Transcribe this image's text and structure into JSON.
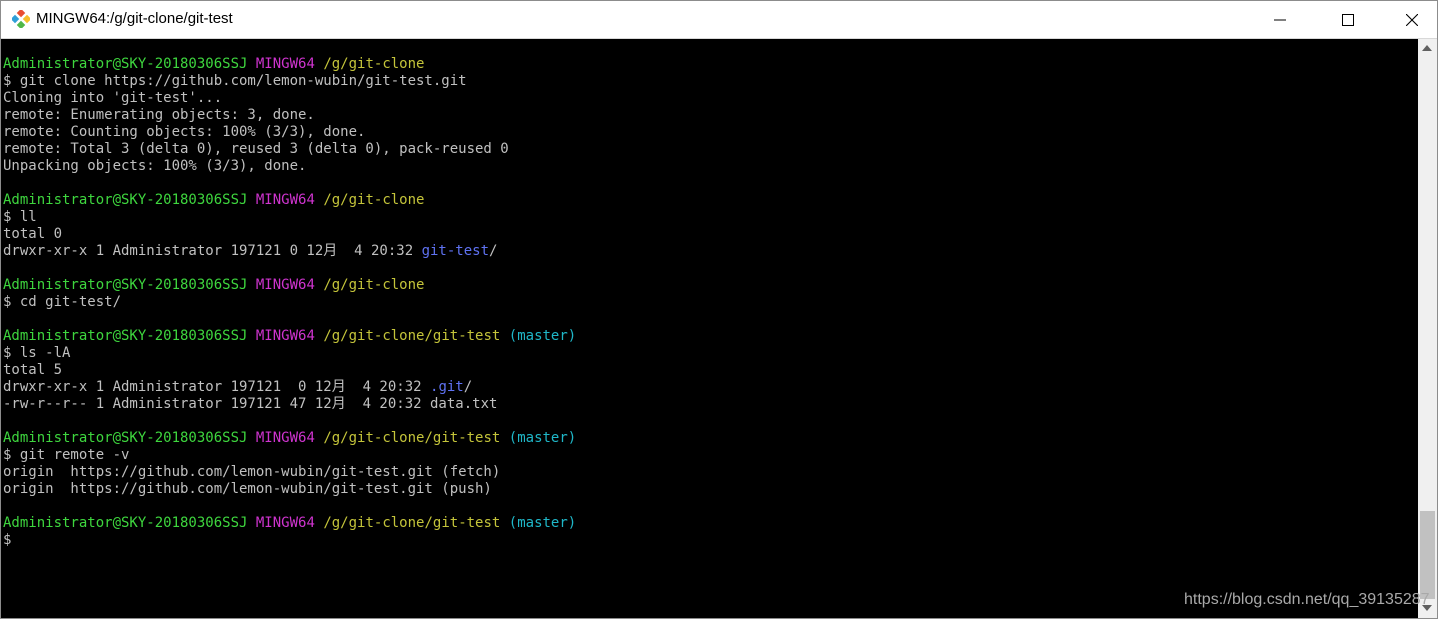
{
  "window": {
    "title": "MINGW64:/g/git-clone/git-test"
  },
  "colors": {
    "user_host": "#3ed63e",
    "shell": "#cf34cf",
    "path": "#c4c43a",
    "branch": "#1fb7c8",
    "directory": "#5f72f2",
    "text": "#c0c0c0",
    "background": "#000000"
  },
  "terminal": {
    "lines": [
      [
        [
          "Administrator@SKY-20180306SSJ",
          "green"
        ],
        [
          " ",
          ""
        ],
        [
          "MINGW64",
          "magenta"
        ],
        [
          " ",
          ""
        ],
        [
          "/g/git-clone",
          "yellow"
        ]
      ],
      [
        [
          "$ git clone https://github.com/lemon-wubin/git-test.git",
          ""
        ]
      ],
      [
        [
          "Cloning into 'git-test'...",
          ""
        ]
      ],
      [
        [
          "remote: Enumerating objects: 3, done.",
          ""
        ]
      ],
      [
        [
          "remote: Counting objects: 100% (3/3), done.",
          ""
        ]
      ],
      [
        [
          "remote: Total 3 (delta 0), reused 3 (delta 0), pack-reused 0",
          ""
        ]
      ],
      [
        [
          "Unpacking objects: 100% (3/3), done.",
          ""
        ]
      ],
      [],
      [
        [
          "Administrator@SKY-20180306SSJ",
          "green"
        ],
        [
          " ",
          ""
        ],
        [
          "MINGW64",
          "magenta"
        ],
        [
          " ",
          ""
        ],
        [
          "/g/git-clone",
          "yellow"
        ]
      ],
      [
        [
          "$ ll",
          ""
        ]
      ],
      [
        [
          "total 0",
          ""
        ]
      ],
      [
        [
          "drwxr-xr-x 1 Administrator 197121 0 12月  4 20:32 ",
          ""
        ],
        [
          "git-test",
          "blue"
        ],
        [
          "/",
          ""
        ]
      ],
      [],
      [
        [
          "Administrator@SKY-20180306SSJ",
          "green"
        ],
        [
          " ",
          ""
        ],
        [
          "MINGW64",
          "magenta"
        ],
        [
          " ",
          ""
        ],
        [
          "/g/git-clone",
          "yellow"
        ]
      ],
      [
        [
          "$ cd git-test/",
          ""
        ]
      ],
      [],
      [
        [
          "Administrator@SKY-20180306SSJ",
          "green"
        ],
        [
          " ",
          ""
        ],
        [
          "MINGW64",
          "magenta"
        ],
        [
          " ",
          ""
        ],
        [
          "/g/git-clone/git-test",
          "yellow"
        ],
        [
          " ",
          ""
        ],
        [
          "(master)",
          "cyan"
        ]
      ],
      [
        [
          "$ ls -lA",
          ""
        ]
      ],
      [
        [
          "total 5",
          ""
        ]
      ],
      [
        [
          "drwxr-xr-x 1 Administrator 197121  0 12月  4 20:32 ",
          ""
        ],
        [
          ".git",
          "blue"
        ],
        [
          "/",
          ""
        ]
      ],
      [
        [
          "-rw-r--r-- 1 Administrator 197121 47 12月  4 20:32 data.txt",
          ""
        ]
      ],
      [],
      [
        [
          "Administrator@SKY-20180306SSJ",
          "green"
        ],
        [
          " ",
          ""
        ],
        [
          "MINGW64",
          "magenta"
        ],
        [
          " ",
          ""
        ],
        [
          "/g/git-clone/git-test",
          "yellow"
        ],
        [
          " ",
          ""
        ],
        [
          "(master)",
          "cyan"
        ]
      ],
      [
        [
          "$ git remote -v",
          ""
        ]
      ],
      [
        [
          "origin  https://github.com/lemon-wubin/git-test.git (fetch)",
          ""
        ]
      ],
      [
        [
          "origin  https://github.com/lemon-wubin/git-test.git (push)",
          ""
        ]
      ],
      [],
      [
        [
          "Administrator@SKY-20180306SSJ",
          "green"
        ],
        [
          " ",
          ""
        ],
        [
          "MINGW64",
          "magenta"
        ],
        [
          " ",
          ""
        ],
        [
          "/g/git-clone/git-test",
          "yellow"
        ],
        [
          " ",
          ""
        ],
        [
          "(master)",
          "cyan"
        ]
      ],
      [
        [
          "$",
          ""
        ]
      ]
    ]
  },
  "watermark": "https://blog.csdn.net/qq_39135287"
}
